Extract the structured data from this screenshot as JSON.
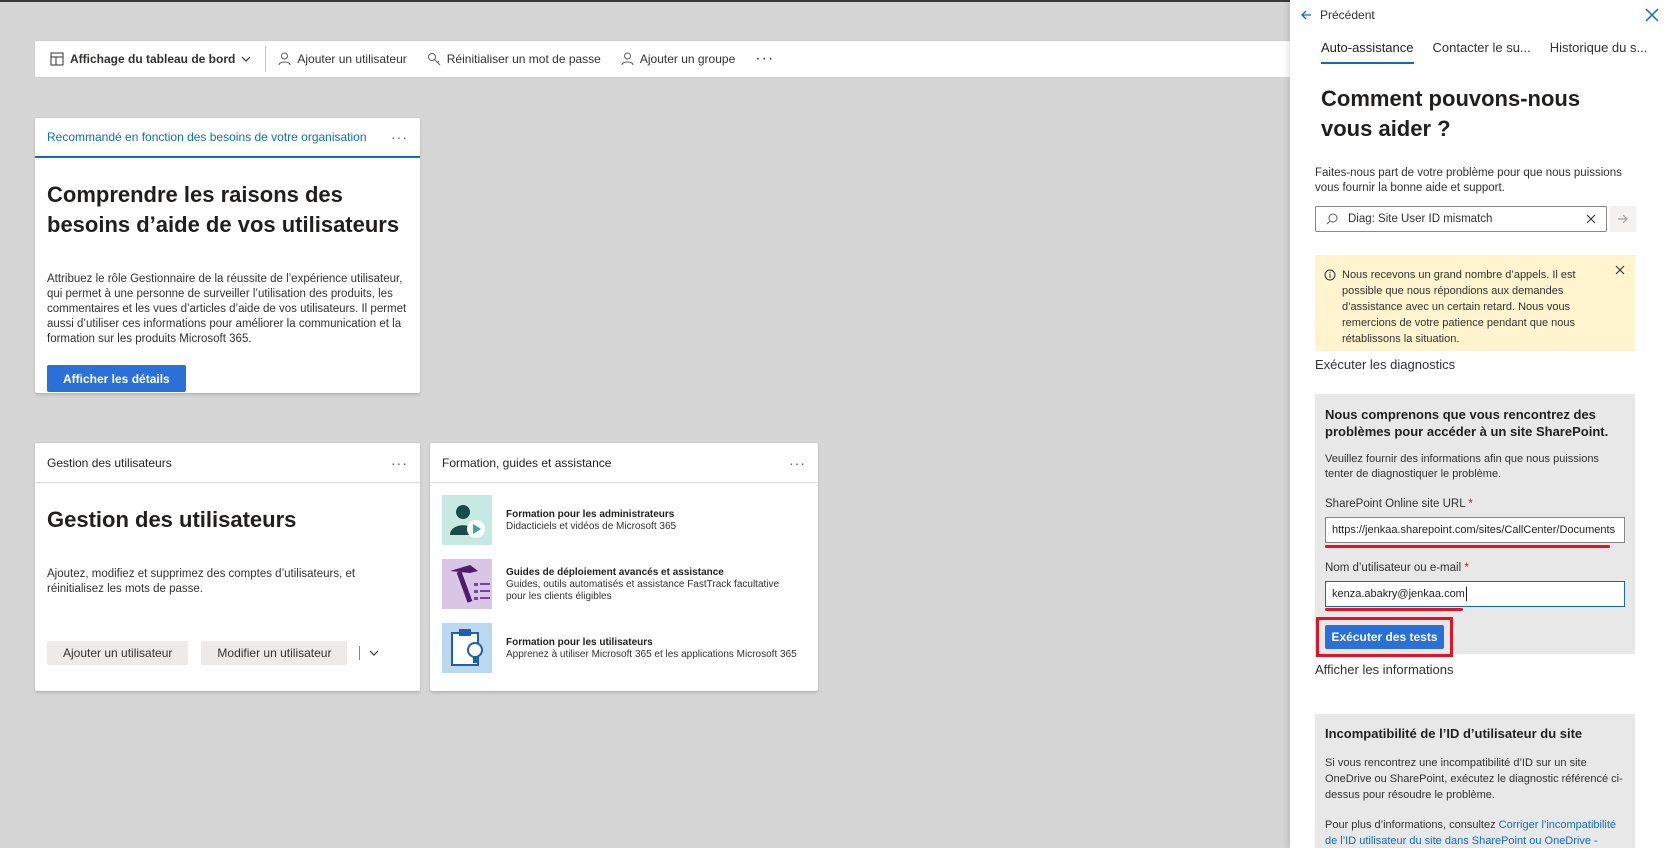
{
  "commandbar": {
    "dashboard_view": "Affichage du tableau de bord",
    "add_user": "Ajouter un utilisateur",
    "reset_password": "Réinitialiser un mot de passe",
    "add_group": "Ajouter un groupe",
    "more": "···"
  },
  "card_recommended": {
    "header": "Recommandé en fonction des besoins de votre organisation",
    "title": "Comprendre les raisons des besoins d’aide de vos utilisateurs",
    "description": "Attribuez le rôle Gestionnaire de la réussite de l’expérience utilisateur, qui permet à une personne de surveiller l’utilisation des produits, les commentaires et les vues d’articles d’aide de vos utilisateurs. Il permet aussi d’utiliser ces informations pour améliorer la communication et la formation sur les produits Microsoft 365.",
    "button": "Afficher les détails"
  },
  "card_users": {
    "header": "Gestion des utilisateurs",
    "title": "Gestion des utilisateurs",
    "description": "Ajoutez, modifiez et supprimez des comptes d’utilisateurs, et réinitialisez les mots de passe.",
    "add_button": "Ajouter un utilisateur",
    "edit_button": "Modifier un utilisateur"
  },
  "card_training": {
    "header": "Formation, guides et assistance",
    "items": [
      {
        "title": "Formation pour les administrateurs",
        "subtitle": "Didacticiels et vidéos de Microsoft 365",
        "icon": "admin-training-icon"
      },
      {
        "title": "Guides de déploiement avancés et assistance",
        "subtitle": "Guides, outils automatisés et assistance FastTrack facultative pour les clients éligibles",
        "icon": "hammer-checklist-icon"
      },
      {
        "title": "Formation pour les utilisateurs",
        "subtitle": "Apprenez à utiliser Microsoft 365 et les applications Microsoft 365",
        "icon": "clipboard-lightbulb-icon"
      }
    ]
  },
  "panel": {
    "back_label": "Précédent",
    "tabs": [
      "Auto-assistance",
      "Contacter le su...",
      "Historique du s..."
    ],
    "heading": "Comment pouvons-nous vous aider ?",
    "intro": "Faites-nous part de votre problème pour que nous puissions vous fournir la bonne aide et support.",
    "search_value": "Diag: Site User ID mismatch",
    "alert": "Nous recevons un grand nombre d’appels. Il est possible que nous répondions aux demandes d’assistance avec un certain retard. Nous vous remercions de votre patience pendant que nous rétablissons la situation.",
    "diagnostics_label": "Exécuter les diagnostics",
    "diag_title": "Nous comprenons que vous rencontrez des problèmes pour accéder à un site SharePoint.",
    "diag_text": "Veuillez fournir des informations afin que nous puissions tenter de diagnostiquer le problème.",
    "url_label": "SharePoint Online site URL",
    "url_value": "https://jenkaa.sharepoint.com/sites/CallCenter/Documents",
    "user_label": "Nom d’utilisateur ou e-mail",
    "user_value": "kenza.abakry@jenkaa.com",
    "required_mark": "*",
    "run_button": "Exécuter des tests",
    "info_label": "Afficher les informations",
    "info_title": "Incompatibilité de l’ID d’utilisateur du site",
    "info_text": "Si vous rencontrez une incompatibilité d’ID sur un site OneDrive ou SharePoint, exécutez le diagnostic référencé ci-dessus pour résoudre le problème.",
    "info_more_prefix": "Pour plus d’informations, consultez ",
    "info_link": "Corriger l’incompatibilité de l’ID utilisateur du site dans SharePoint ou OneDrive -"
  },
  "colors": {
    "accent": "#0f6cbd",
    "primary_button": "#2b6fd8",
    "highlight": "#e81123",
    "alert_bg": "#fff4ce"
  }
}
